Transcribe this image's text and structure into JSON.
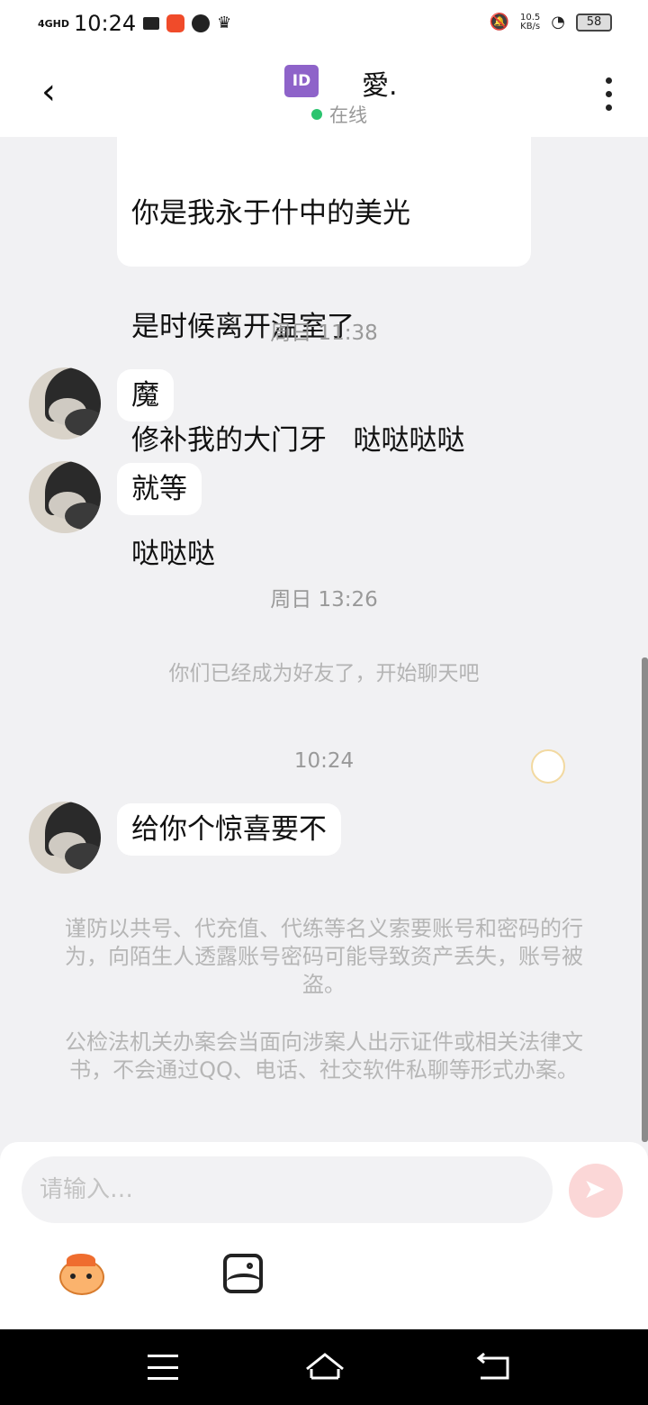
{
  "status_bar": {
    "signal": "4GHD",
    "time": "10:24",
    "net_speed_value": "10.5",
    "net_speed_unit": "KB/s",
    "battery": "58",
    "icons": [
      "video-camera-icon",
      "app-icon",
      "play-icon",
      "crown-icon",
      "mute-icon",
      "wifi-icon",
      "battery-icon"
    ]
  },
  "header": {
    "badge": "ID",
    "title": "愛.",
    "status": "在线"
  },
  "messages": {
    "first_bubble_lines": [
      "你是我永于什中的美光",
      "是时候离开温室了",
      "修补我的大门牙   哒哒哒哒",
      "哒哒哒"
    ],
    "time_1": "周日 11:38",
    "msg_1": "魔",
    "msg_2": "就等",
    "time_2": "周日 13:26",
    "friend_notice": "你们已经成为好友了，开始聊天吧",
    "time_3": "10:24",
    "msg_3": "给你个惊喜要不"
  },
  "warnings": {
    "warning_1": "谨防以共号、代充值、代练等名义索要账号和密码的行为，向陌生人透露账号密码可能导致资产丢失，账号被盗。",
    "warning_2": "公检法机关办案会当面向涉案人出示证件或相关法律文书，不会通过QQ、电话、社交软件私聊等形式办案。"
  },
  "input_bar": {
    "placeholder": "请输入…",
    "send_color": "#fbd7d7"
  },
  "colors": {
    "online_dot": "#2bc46f",
    "badge": "#8e63c9",
    "background": "#f1f1f3"
  }
}
